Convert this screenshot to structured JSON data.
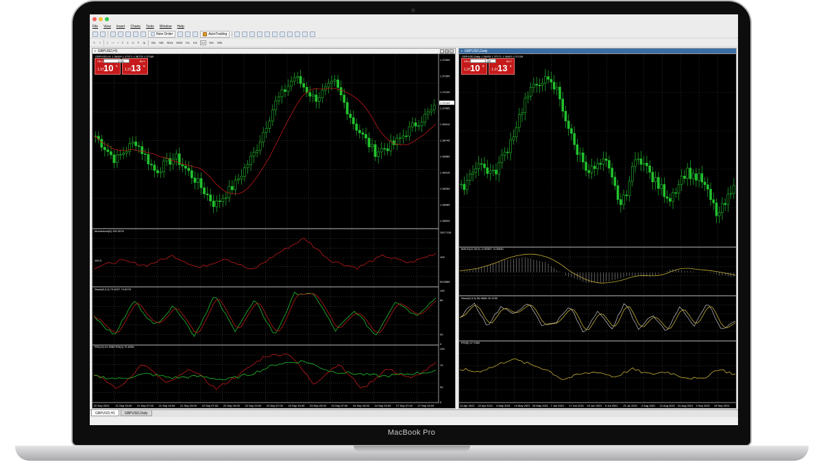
{
  "device": {
    "model_label": "MacBook Pro"
  },
  "menu": [
    "File",
    "View",
    "Insert",
    "Charts",
    "Tools",
    "Window",
    "Help"
  ],
  "toolbar": {
    "new_order": "New Order",
    "autotrading": "AutoTrading"
  },
  "timeframes": [
    "M1",
    "M5",
    "M15",
    "M30",
    "H1",
    "H4",
    "D1",
    "W1",
    "MN"
  ],
  "charts": [
    {
      "window_title": "GBPUSD,H1",
      "ohlc": "GBPUSD,H1  1.36459 1.37071 1.36733 1.37169",
      "trade": {
        "sell_label": "SELL",
        "buy_label": "BUY",
        "lot": "1.01",
        "sell_prefix": "1.37",
        "sell_big": "10",
        "sell_sup": "9",
        "buy_prefix": "1.37",
        "buy_big": "13",
        "buy_sup": "6"
      },
      "price_labels": [
        "1.37555",
        "1.37390",
        "1.37230",
        "1.37065",
        "1.36910",
        "1.36745",
        "1.36580",
        "1.36415",
        "1.36250",
        "1.36085",
        "1.35920"
      ],
      "price_current": "1.37109",
      "indicators": [
        {
          "label": "Momentum(8) 100.2576",
          "levels": [
            "100.7115",
            "100",
            "99.5565"
          ],
          "side_label": "100.3"
        },
        {
          "label": "Stoch(8,3,3) 73.6237 74.6276",
          "levels": [
            "100",
            "80",
            "20",
            "0"
          ]
        },
        {
          "label": "RSI(13) 61.9085  RSI(3) 75.6256",
          "levels": [
            "100",
            "70",
            "30",
            "0"
          ]
        }
      ],
      "time_labels": [
        "20 Sep 2021",
        "21 Sep 03:00",
        "21 Sep 07:00",
        "21 Sep 15:00",
        "21 Sep 23:00",
        "22 Sep 07:00",
        "22 Sep 15:00",
        "22 Sep 23:00",
        "23 Sep 07:00",
        "23 Sep 15:00",
        "23 Sep 23:00",
        "24 Sep 07:00",
        "24 Sep 15:00",
        "24 Sep 23:00",
        "27 Sep 07:00",
        "27 Sep 15:00"
      ],
      "colors": {
        "candle": "#22c22e",
        "ma": "#c41a1a",
        "momentum": "#c41a1a",
        "stoch_main": "#22c22e",
        "stoch_signal": "#c41a1a",
        "rsi_main": "#22c22e",
        "rsi_fast": "#c41a1a"
      }
    },
    {
      "window_title": "GBPUSD,Daily",
      "ohlc": "GBPUSD,Daily  1.36435 1.37171 1.36403 1.37109",
      "trade": {
        "sell_label": "SELL",
        "buy_label": "BUY",
        "lot": "1.00",
        "sell_prefix": "1.37",
        "sell_big": "10",
        "sell_sup": "9",
        "buy_prefix": "1.37",
        "buy_big": "13",
        "buy_sup": "6"
      },
      "indicators": [
        {
          "label": "MACD(12,26,9) -0.00387 -0.00530"
        },
        {
          "label": "Stoch(5,3,3) 36.9836 25.1230"
        },
        {
          "label": "RSI(8) 47.2460"
        }
      ],
      "time_labels": [
        "12 Apr 2021",
        "22 Apr 2021",
        "4 May 2021",
        "14 May 2021",
        "26 May 2021",
        "7 Jun 2021",
        "17 Jun 2021",
        "29 Jun 2021",
        "9 Jul 2021",
        "21 Jul 2021",
        "2 Aug 2021",
        "12 Aug 2021",
        "24 Aug 2021",
        "3 Sep 2021",
        "15 Sep 2021"
      ],
      "colors": {
        "candle": "#22c22e",
        "macd": "#c8b23a",
        "stoch": "#c8b23a",
        "rsi": "#c8b23a"
      }
    }
  ],
  "tabs": [
    "GBPUSD,H1",
    "GBPUSD,Daily"
  ]
}
